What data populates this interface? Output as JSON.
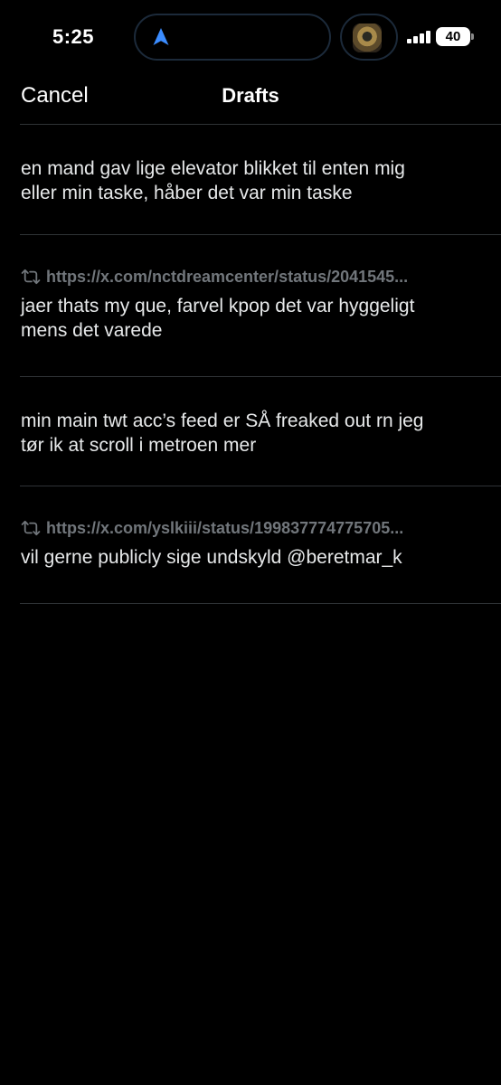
{
  "status_bar": {
    "time": "5:25",
    "battery": "40",
    "location_icon": "location-arrow-icon",
    "signal_icon": "cellular-signal-icon"
  },
  "header": {
    "cancel_label": "Cancel",
    "title": "Drafts"
  },
  "drafts": [
    {
      "text": "en mand gav lige elevator blikket til enten mig\neller min taske, håber det var min taske"
    },
    {
      "quote_url": "https://x.com/nctdreamcenter/status/2041545...",
      "text": "jaer thats my que, farvel kpop det var hyggeligt\nmens det varede"
    },
    {
      "text": "min main twt acc’s feed er SÅ freaked out rn jeg\ntør ik at scroll i metroen mer"
    },
    {
      "quote_url": "https://x.com/yslkiii/status/199837774775705...",
      "text": "vil gerne publicly sige undskyld @beretmar_k"
    }
  ],
  "colors": {
    "background": "#000000",
    "text": "#e7e9ea",
    "secondary_text": "#71767b",
    "divider": "#2f3336",
    "accent_location": "#3b8cff"
  }
}
